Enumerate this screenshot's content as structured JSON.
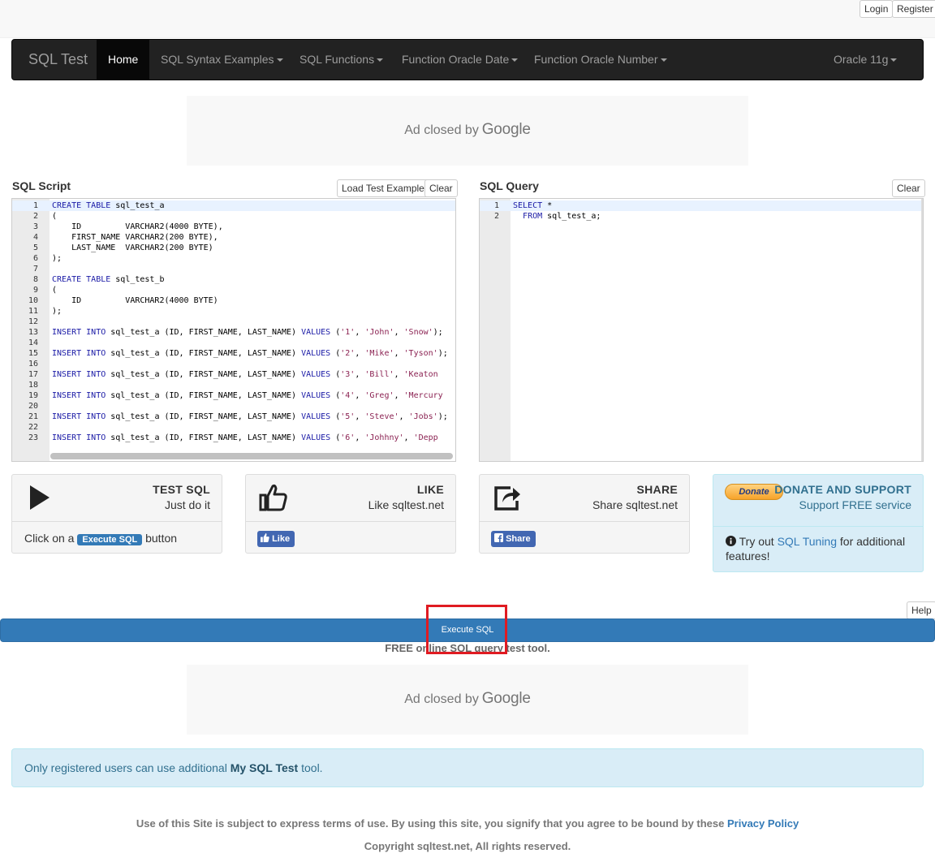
{
  "auth": {
    "login_label": "Login",
    "register_label": "Register"
  },
  "nav": {
    "brand": "SQL Test",
    "home": "Home",
    "items": [
      "SQL Syntax Examples",
      "SQL Functions",
      "Function Oracle Date",
      "Function Oracle Number"
    ],
    "db_selector": "Oracle 11g"
  },
  "ad": {
    "text": "Ad closed by",
    "brand": "Google"
  },
  "script_panel": {
    "title": "SQL Script",
    "load_example_label": "Load Test Example",
    "clear_label": "Clear",
    "lines": [
      "CREATE TABLE sql_test_a",
      "(",
      "    ID         VARCHAR2(4000 BYTE),",
      "    FIRST_NAME VARCHAR2(200 BYTE),",
      "    LAST_NAME  VARCHAR2(200 BYTE)",
      ");",
      "",
      "CREATE TABLE sql_test_b",
      "(",
      "    ID         VARCHAR2(4000 BYTE)",
      ");",
      "",
      "INSERT INTO sql_test_a (ID, FIRST_NAME, LAST_NAME) VALUES ('1', 'John', 'Snow');",
      "",
      "INSERT INTO sql_test_a (ID, FIRST_NAME, LAST_NAME) VALUES ('2', 'Mike', 'Tyson');",
      "",
      "INSERT INTO sql_test_a (ID, FIRST_NAME, LAST_NAME) VALUES ('3', 'Bill', 'Keaton",
      "",
      "INSERT INTO sql_test_a (ID, FIRST_NAME, LAST_NAME) VALUES ('4', 'Greg', 'Mercury",
      "",
      "INSERT INTO sql_test_a (ID, FIRST_NAME, LAST_NAME) VALUES ('5', 'Steve', 'Jobs');",
      "",
      "INSERT INTO sql_test_a (ID, FIRST_NAME, LAST_NAME) VALUES ('6', 'Johhny', 'Depp"
    ]
  },
  "query_panel": {
    "title": "SQL Query",
    "clear_label": "Clear",
    "lines": [
      "SELECT *",
      "  FROM sql_test_a;"
    ]
  },
  "cards": {
    "test": {
      "title": "TEST SQL",
      "subtitle": "Just do it",
      "foot_prefix": "Click on a",
      "foot_badge": "Execute SQL",
      "foot_suffix": "button"
    },
    "like": {
      "title": "LIKE",
      "subtitle": "Like sqltest.net",
      "button": "Like"
    },
    "share": {
      "title": "SHARE",
      "subtitle": "Share sqltest.net",
      "button": "Share"
    },
    "donate": {
      "paypal_label": "Donate",
      "title": "DONATE AND SUPPORT",
      "subtitle": "Support FREE service",
      "info_prefix": "Try out",
      "info_link": "SQL Tuning",
      "info_suffix": "for additional features!"
    }
  },
  "execute": {
    "help_label": "Help",
    "button_label": "Execute SQL",
    "tagline": "FREE online SQL query test tool."
  },
  "alert": {
    "prefix": "Only registered users can use additional",
    "link": "My SQL Test",
    "suffix": "tool."
  },
  "footer": {
    "terms": "Use of this Site is subject to express terms of use. By using this site, you signify that you agree to be bound by these",
    "privacy_link": "Privacy Policy",
    "copyright": "Copyright sqltest.net, All rights reserved."
  },
  "colors": {
    "navbar": "#222222",
    "primary": "#337ab7",
    "info_bg": "#d9edf7",
    "highlight": "#e01b22"
  }
}
